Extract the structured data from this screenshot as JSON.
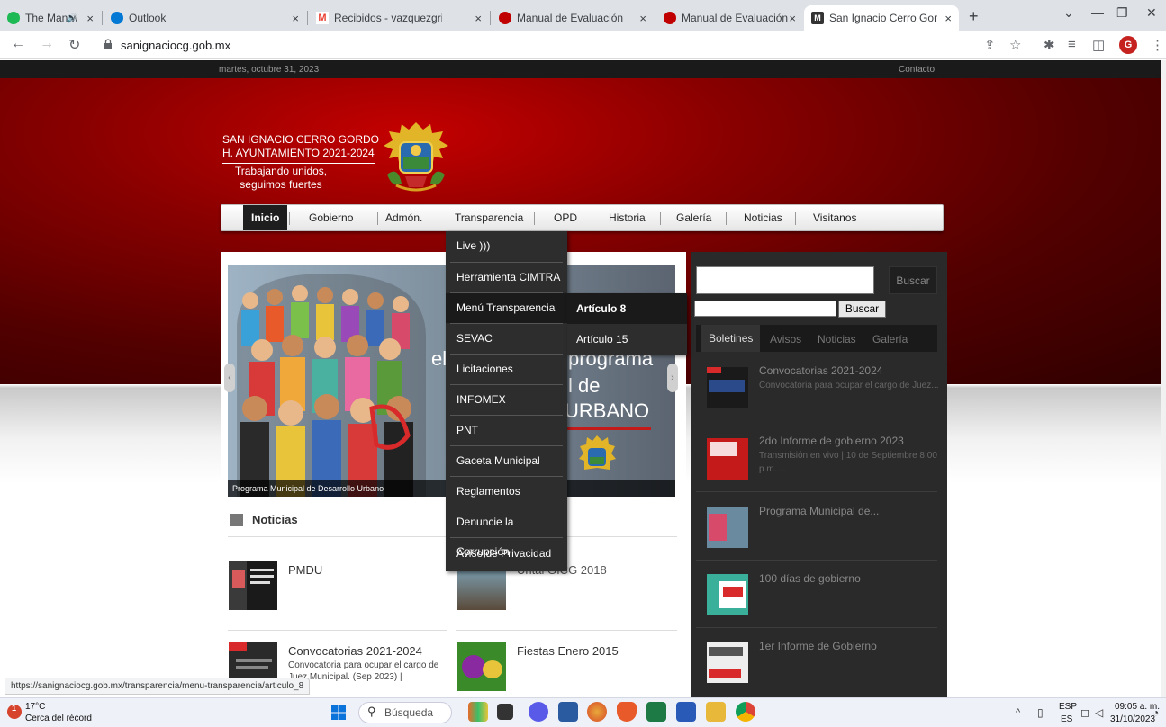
{
  "browser": {
    "tabs": [
      {
        "title": "The Man with the A",
        "favicon": "spotify-icon",
        "color": "#1db954"
      },
      {
        "title": "Outlook",
        "favicon": "outlook-icon",
        "color": "#0078d4"
      },
      {
        "title": "Recibidos - vazquezgris",
        "favicon": "gmail-icon",
        "color": "#ea4335"
      },
      {
        "title": "Manual de Evaluación d",
        "favicon": "red-circle-icon",
        "color": "#c00000"
      },
      {
        "title": "Manual de Evaluación d",
        "favicon": "red-circle-icon",
        "color": "#c00000"
      },
      {
        "title": "San Ignacio Cerro Gord",
        "favicon": "site-icon",
        "color": "#444444"
      }
    ],
    "close_glyph": "×",
    "audio_glyph": "🔊",
    "new_tab": "+",
    "url": "sanignaciocg.gob.mx",
    "status_url": "https://sanignaciocg.gob.mx/transparencia/menu-transparencia/articulo_8",
    "profile_initial": "G"
  },
  "site": {
    "date": "martes, octubre 31, 2023",
    "contact": "Contacto",
    "banner": {
      "line1": "SAN IGNACIO CERRO GORDO",
      "line2": "H. AYUNTAMIENTO 2021-2024",
      "line3": "Trabajando unidos,",
      "line4": "seguimos fuertes"
    },
    "nav": [
      "Inicio",
      "Gobierno",
      "Admón.",
      "Transparencia",
      "OPD",
      "Historia",
      "Galería",
      "Noticias",
      "Visitanos"
    ],
    "dropdown": [
      "Live )))",
      "Herramienta CIMTRA",
      "Menú Transparencia",
      "SEVAC",
      "Licitaciones",
      "INFOMEX",
      "PNT",
      "Gaceta Municipal",
      "Reglamentos",
      "Denuncie la Corrupción",
      "Aviso de Privacidad"
    ],
    "submenu": [
      "Artículo 8",
      "Artículo 15"
    ],
    "slider": {
      "text1": "el",
      "text2": "programa",
      "text3": "l de",
      "text4": "URBANO",
      "caption": "Programa Municipal de Desarrollo Urbano"
    },
    "news_title": "Noticias",
    "news": [
      {
        "title": "PMDU",
        "excerpt": ""
      },
      {
        "title": "Untal GICG 2018",
        "excerpt": ""
      },
      {
        "title": "Convocatorias 2021-2024",
        "excerpt": "Convocatoria para ocupar el cargo de Juez Municipal. (Sep 2023) |"
      },
      {
        "title": "Fiestas Enero 2015",
        "excerpt": ""
      }
    ],
    "sidebar": {
      "search_button": "Buscar",
      "search_button2": "Buscar",
      "tabs": [
        "Boletines",
        "Avisos",
        "Noticias",
        "Galería"
      ],
      "items": [
        {
          "title": "Convocatorias 2021-2024",
          "excerpt": "Convocatoria para ocupar el cargo de Juez..."
        },
        {
          "title": "2do Informe de gobierno 2023",
          "excerpt": "Transmisión en vivo | 10 de Septiembre 8:00 p.m. ..."
        },
        {
          "title": "Programa Municipal de...",
          "excerpt": ""
        },
        {
          "title": "100 días de gobierno",
          "excerpt": ""
        },
        {
          "title": "1er Informe de Gobierno",
          "excerpt": ""
        }
      ]
    }
  },
  "taskbar": {
    "weather_temp": "17°C",
    "weather_desc": "Cerca del récord",
    "weather_badge": "1",
    "search": "Búsqueda",
    "lang1": "ESP",
    "lang2": "ES",
    "time": "09:05 a. m.",
    "date": "31/10/2023"
  }
}
